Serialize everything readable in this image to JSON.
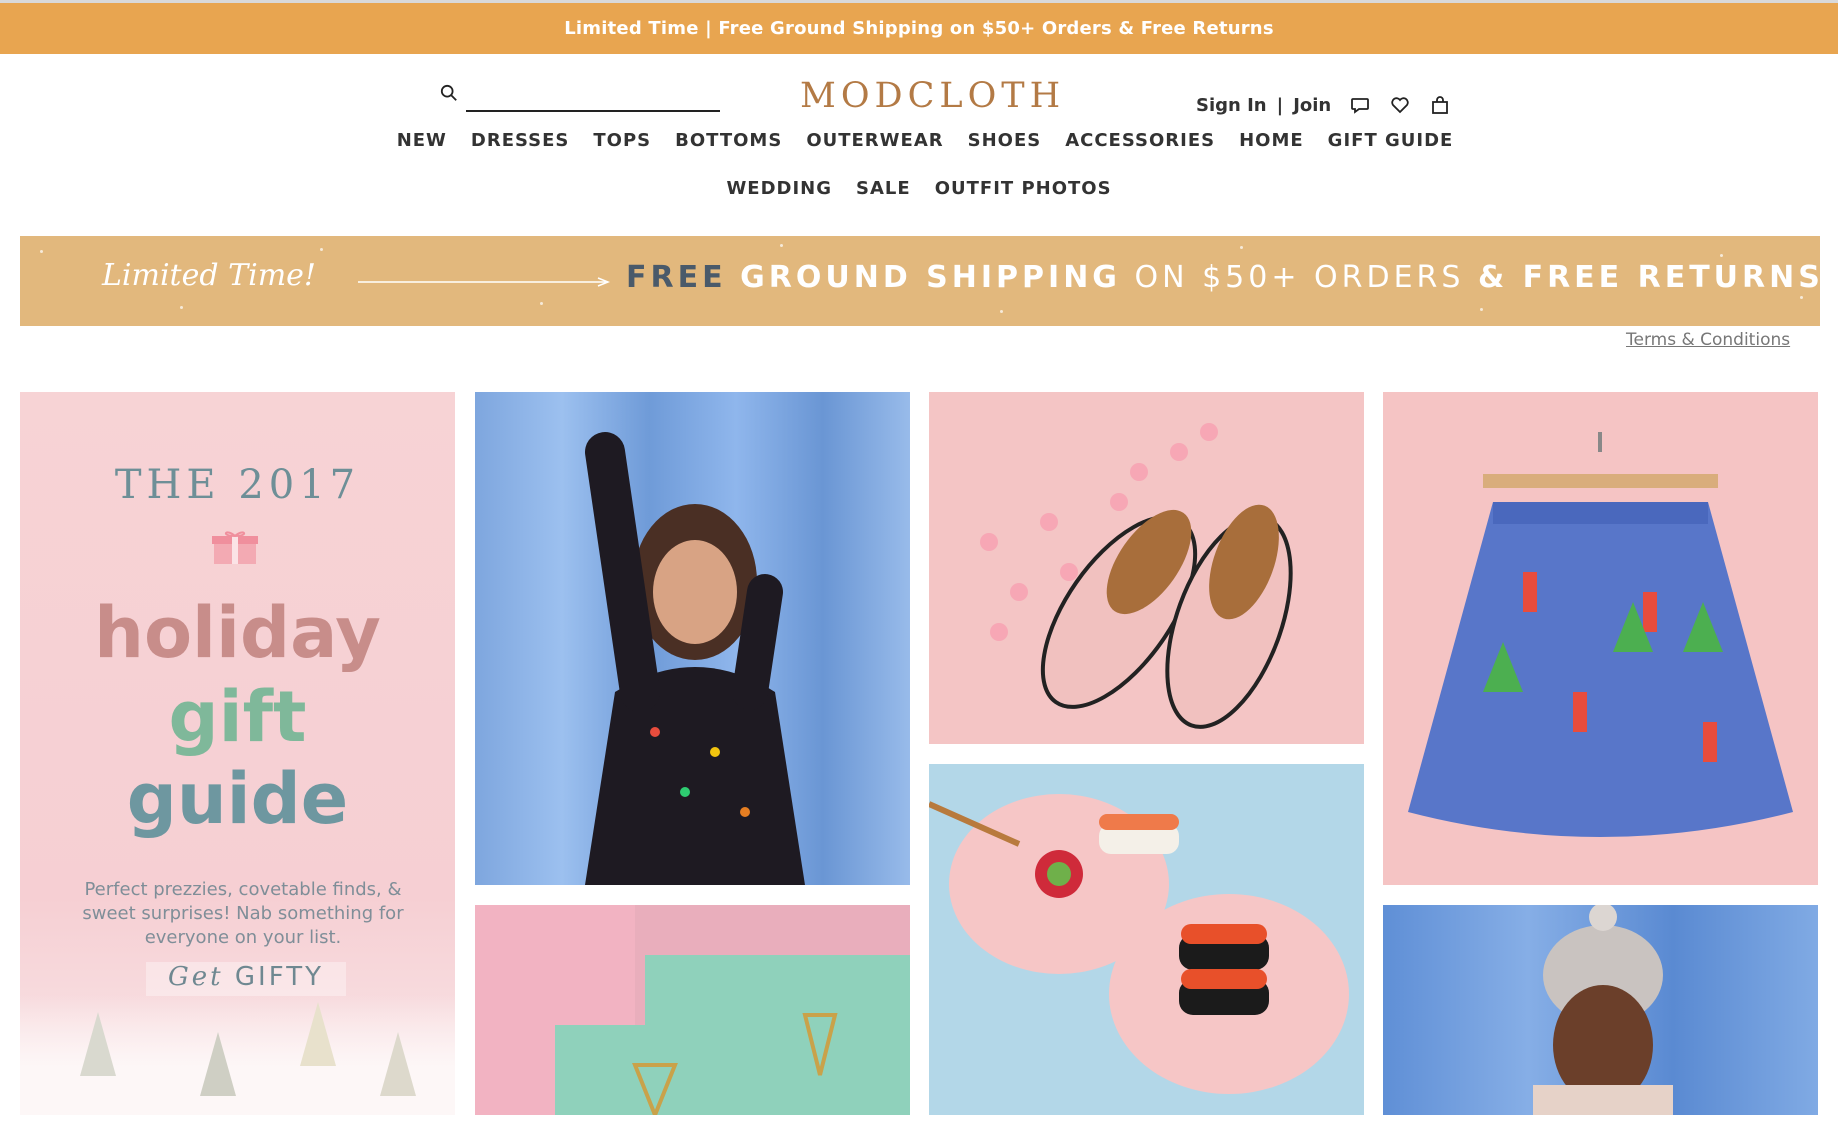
{
  "topbar": {
    "text": "Limited Time | Free Ground Shipping on $50+ Orders & Free Returns"
  },
  "header": {
    "logo": "MODCLOTH",
    "search_placeholder": "",
    "sign_in": "Sign In",
    "separator": "|",
    "join": "Join",
    "icons": [
      "search-icon",
      "chat-icon",
      "heart-icon",
      "bag-icon"
    ]
  },
  "nav": {
    "row1": [
      "NEW",
      "DRESSES",
      "TOPS",
      "BOTTOMS",
      "OUTERWEAR",
      "SHOES",
      "ACCESSORIES",
      "HOME",
      "GIFT GUIDE"
    ],
    "row2": [
      "WEDDING",
      "SALE",
      "OUTFIT PHOTOS"
    ]
  },
  "promo": {
    "limited": "Limited Time!",
    "part_a": "FREE",
    "part_b": "GROUND SHIPPING",
    "part_c": "ON $50+ ORDERS",
    "part_d": "& FREE RETURNS"
  },
  "terms": "Terms & Conditions",
  "gift_tile": {
    "year": "THE 2017",
    "word1": "holiday",
    "word2": "gift",
    "word3": "guide",
    "desc": "Perfect prezzies, covetable finds, & sweet surprises! Nab something for everyone on your list.",
    "cta_italic": "Get",
    "cta_rest": "GIFTY"
  },
  "colors": {
    "topbar": "#e8a550",
    "promo": "#e2b87d",
    "logo": "#b37a45"
  }
}
